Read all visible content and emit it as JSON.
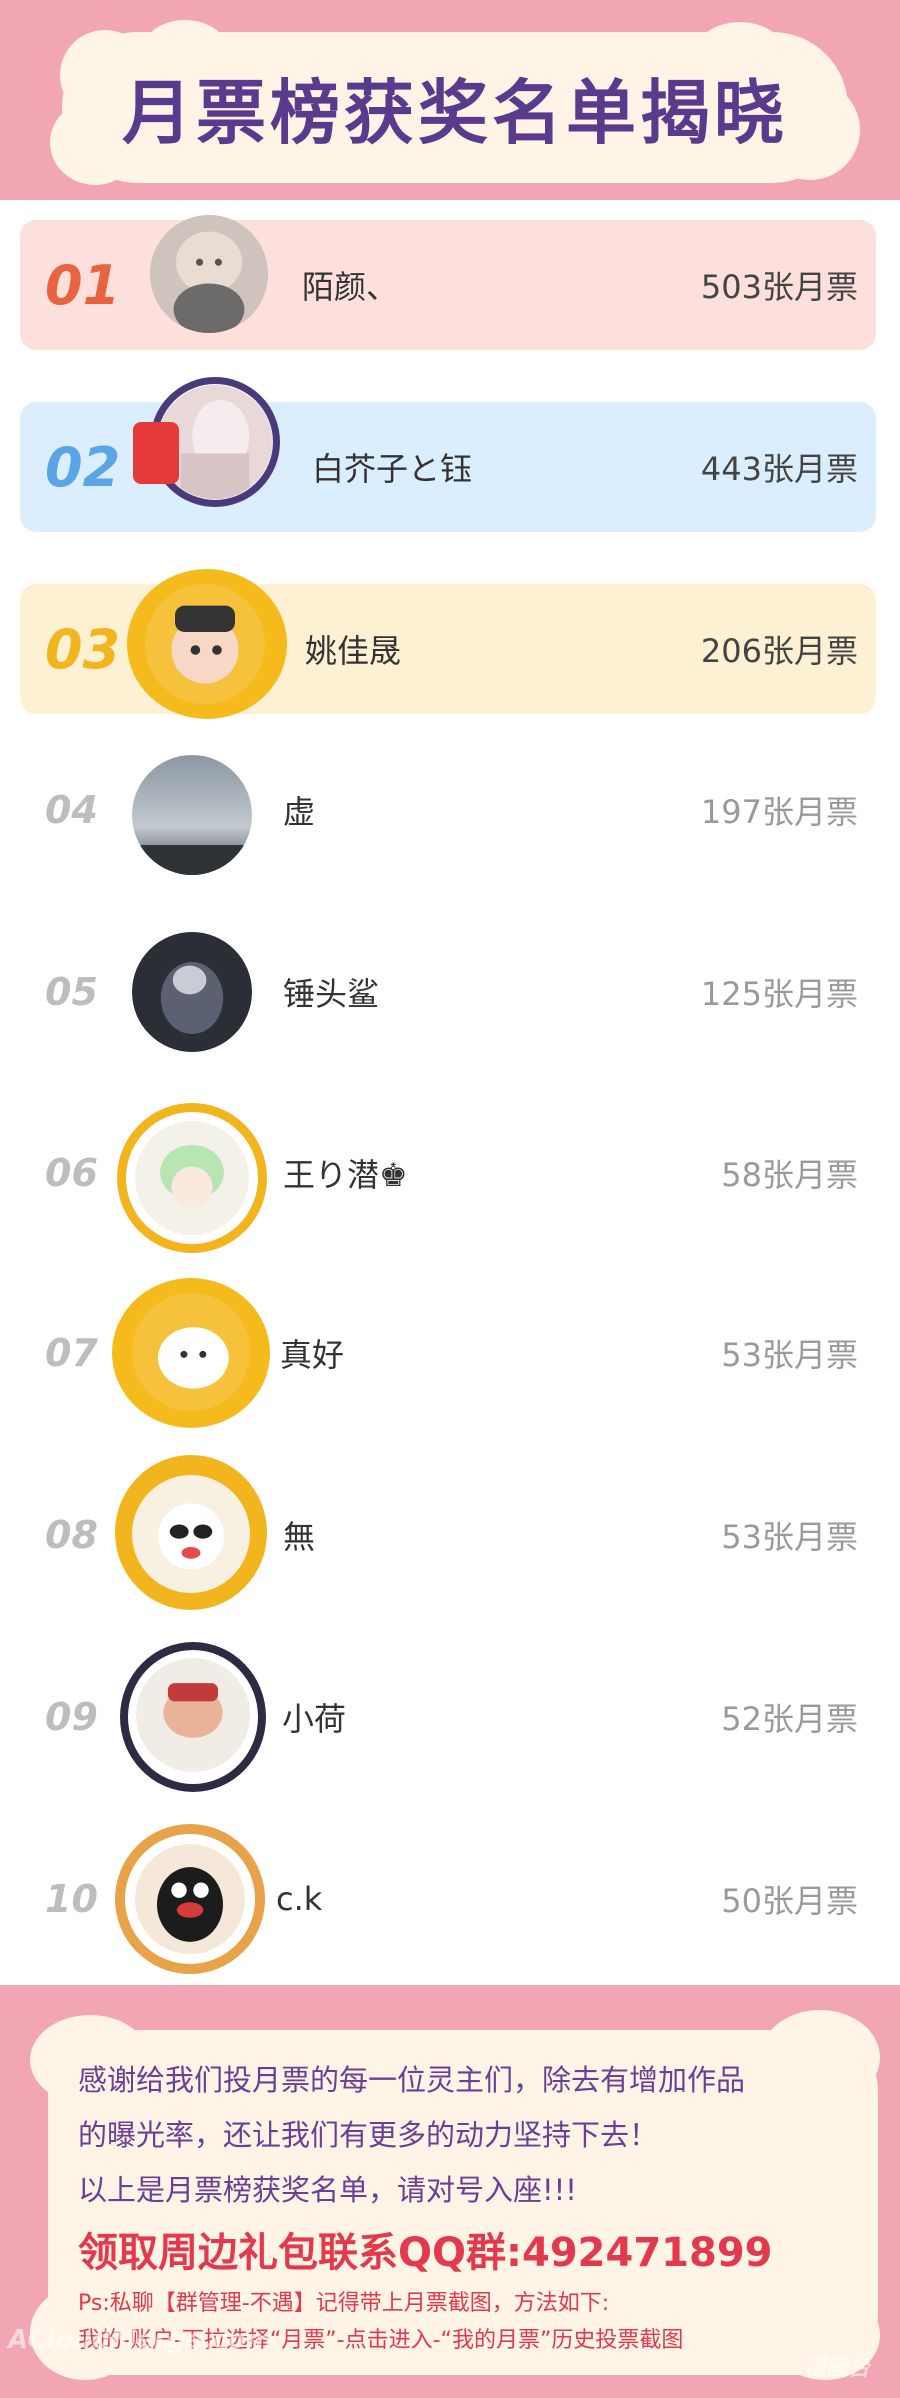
{
  "title": "月票榜获奖名单揭晓",
  "colors": {
    "pink": "#f2a6b4",
    "cream": "#fff4e6",
    "rank1": "#e8633f",
    "rank2": "#5aa5e6",
    "rank3": "#f2b51e",
    "band1": "#fde0dc",
    "band2": "#dbeefd",
    "band3": "#fdf1d3",
    "title": "#5a3a8c"
  },
  "ranking": [
    {
      "rank": "01",
      "name": "陌颜、",
      "votes": "503张月票"
    },
    {
      "rank": "02",
      "name": "白芥子と钰",
      "votes": "443张月票"
    },
    {
      "rank": "03",
      "name": "姚佳晟",
      "votes": "206张月票"
    },
    {
      "rank": "04",
      "name": "虚",
      "votes": "197张月票"
    },
    {
      "rank": "05",
      "name": "锤头鲨",
      "votes": "125张月票"
    },
    {
      "rank": "06",
      "name": "王り潜♚",
      "votes": "58张月票"
    },
    {
      "rank": "07",
      "name": "真好",
      "votes": "53张月票"
    },
    {
      "rank": "08",
      "name": "無",
      "votes": "53张月票"
    },
    {
      "rank": "09",
      "name": "小荷",
      "votes": "52张月票"
    },
    {
      "rank": "10",
      "name": "c.k",
      "votes": "50张月票"
    }
  ],
  "footer": {
    "thanks_line1": "感谢给我们投月票的每一位灵主们，除去有增加作品",
    "thanks_line2": "的曝光率，还让我们有更多的动力坚持下去！",
    "thanks_line3": "以上是月票榜获奖名单，请对号入座!!!",
    "qq_line": "领取周边礼包联系QQ群:492471899",
    "ps_line1": "Ps:私聊【群管理-不遇】记得带上月票截图，方法如下:",
    "ps_line2": "我的-账户-下拉选择“月票”-点击进入-“我的月票”历史投票截图"
  },
  "watermark": "ACloudMerge.com",
  "watermark2": "漫画台"
}
